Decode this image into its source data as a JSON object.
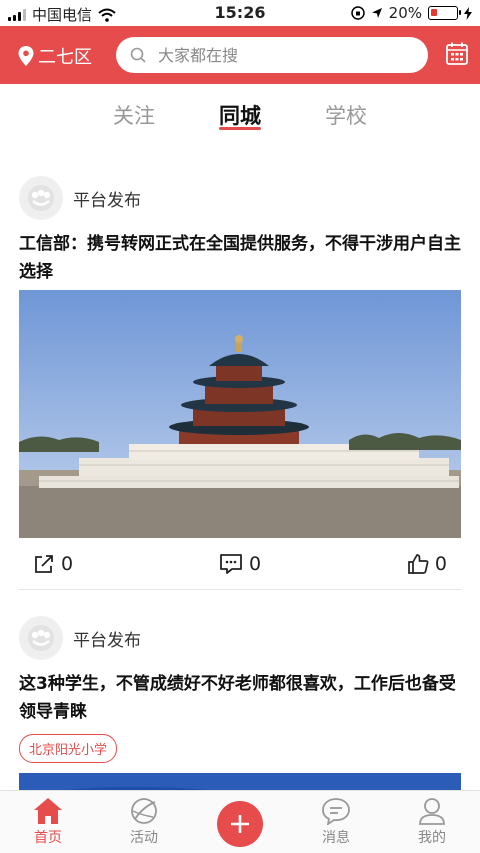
{
  "status_bar": {
    "carrier": "中国电信",
    "time": "15:26",
    "battery": "20%",
    "battery_level": 0.2
  },
  "header": {
    "location": "二七区",
    "search_placeholder": "大家都在搜",
    "icons": [
      "location-pin-icon",
      "search-icon",
      "calendar-icon"
    ],
    "accent_color": "#e74c4c"
  },
  "tabs": [
    {
      "label": "关注",
      "active": false
    },
    {
      "label": "同城",
      "active": true
    },
    {
      "label": "学校",
      "active": false
    }
  ],
  "feed": {
    "posts": [
      {
        "author": "平台发布",
        "title": "工信部：携号转网正式在全国提供服务，不得干涉用户自主选择",
        "share_count": "0",
        "comment_count": "0",
        "like_count": "0"
      },
      {
        "author": "平台发布",
        "title": "这3种学生，不管成绩好不好老师都很喜欢，工作后也备受领导青睐",
        "tag": "北京阳光小学"
      }
    ]
  },
  "bottom_nav": [
    {
      "label": "首页",
      "icon": "home-icon",
      "active": true
    },
    {
      "label": "活动",
      "icon": "activity-icon",
      "active": false
    },
    {
      "label": "",
      "icon": "plus-icon",
      "active": false
    },
    {
      "label": "消息",
      "icon": "message-icon",
      "active": false
    },
    {
      "label": "我的",
      "icon": "profile-icon",
      "active": false
    }
  ]
}
